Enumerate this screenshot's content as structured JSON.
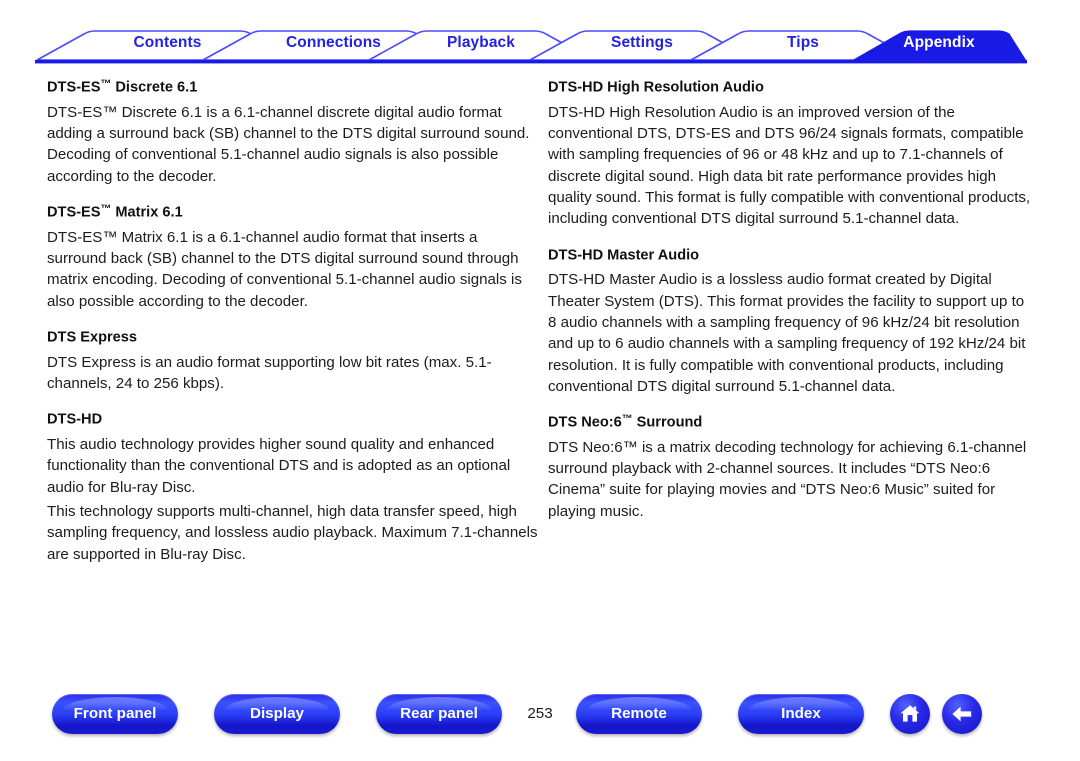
{
  "tabs": [
    {
      "label": "Contents",
      "active": false
    },
    {
      "label": "Connections",
      "active": false
    },
    {
      "label": "Playback",
      "active": false
    },
    {
      "label": "Settings",
      "active": false
    },
    {
      "label": "Tips",
      "active": false
    },
    {
      "label": "Appendix",
      "active": true
    }
  ],
  "colors": {
    "accent_blue": "#2222e0",
    "tab_outline": "#4a4aff",
    "active_tab_fill": "#1a1ae6",
    "rule_blue": "#1a1ae6",
    "text": "#1c1c1c"
  },
  "left_column": [
    {
      "heading_pre": "DTS-ES",
      "heading_tm": "™",
      "heading_post": " Discrete 6.1",
      "paragraphs": [
        "DTS-ES™ Discrete 6.1 is a 6.1-channel discrete digital audio format adding a surround back (SB) channel to the DTS digital surround sound. Decoding of conventional 5.1-channel audio signals is also possible according to the decoder."
      ]
    },
    {
      "heading_pre": "DTS-ES",
      "heading_tm": "™",
      "heading_post": " Matrix 6.1",
      "paragraphs": [
        "DTS-ES™ Matrix 6.1 is a 6.1-channel audio format that inserts a surround back (SB) channel to the DTS digital surround sound through matrix encoding. Decoding of conventional 5.1-channel audio signals is also possible according to the decoder."
      ]
    },
    {
      "heading_pre": "DTS Express",
      "heading_tm": "",
      "heading_post": "",
      "paragraphs": [
        "DTS Express is an audio format supporting low bit rates (max. 5.1-channels, 24 to 256 kbps)."
      ]
    },
    {
      "heading_pre": "DTS-HD",
      "heading_tm": "",
      "heading_post": "",
      "paragraphs": [
        "This audio technology provides higher sound quality and enhanced functionality than the conventional DTS and is adopted as an optional audio for Blu-ray Disc.",
        "This technology supports multi-channel, high data transfer speed, high sampling frequency, and lossless audio playback. Maximum 7.1-channels are supported in Blu-ray Disc."
      ]
    }
  ],
  "right_column": [
    {
      "heading_pre": "DTS-HD High Resolution Audio",
      "heading_tm": "",
      "heading_post": "",
      "paragraphs": [
        "DTS-HD High Resolution Audio is an improved version of the conventional DTS, DTS-ES and DTS 96/24 signals formats, compatible with sampling frequencies of 96 or 48 kHz and up to 7.1-channels of discrete digital sound. High data bit rate performance provides high quality sound. This format is fully compatible with conventional products, including conventional DTS digital surround 5.1-channel data."
      ]
    },
    {
      "heading_pre": "DTS-HD Master Audio",
      "heading_tm": "",
      "heading_post": "",
      "paragraphs": [
        "DTS-HD Master Audio is a lossless audio format created by Digital Theater System (DTS). This format provides the facility to support up to 8 audio channels with a sampling frequency of 96 kHz/24 bit resolution and up to 6 audio channels with a sampling frequency of 192 kHz/24 bit resolution. It is fully compatible with conventional products, including conventional DTS digital surround 5.1-channel data."
      ]
    },
    {
      "heading_pre": "DTS Neo:6",
      "heading_tm": "™",
      "heading_post": " Surround",
      "paragraphs": [
        "DTS Neo:6™ is a matrix decoding technology for achieving 6.1-channel surround playback with 2-channel sources. It includes “DTS Neo:6 Cinema” suite for playing movies and “DTS Neo:6 Music” suited for playing music."
      ]
    }
  ],
  "footer": {
    "buttons": [
      {
        "label": "Front panel",
        "name": "front-panel"
      },
      {
        "label": "Display",
        "name": "display"
      },
      {
        "label": "Rear panel",
        "name": "rear-panel"
      },
      {
        "label": "Remote",
        "name": "remote"
      },
      {
        "label": "Index",
        "name": "index"
      }
    ],
    "page_number": "253",
    "icons": [
      {
        "name": "home-icon",
        "label": "Home"
      },
      {
        "name": "back-arrow-icon",
        "label": "Back"
      }
    ]
  }
}
